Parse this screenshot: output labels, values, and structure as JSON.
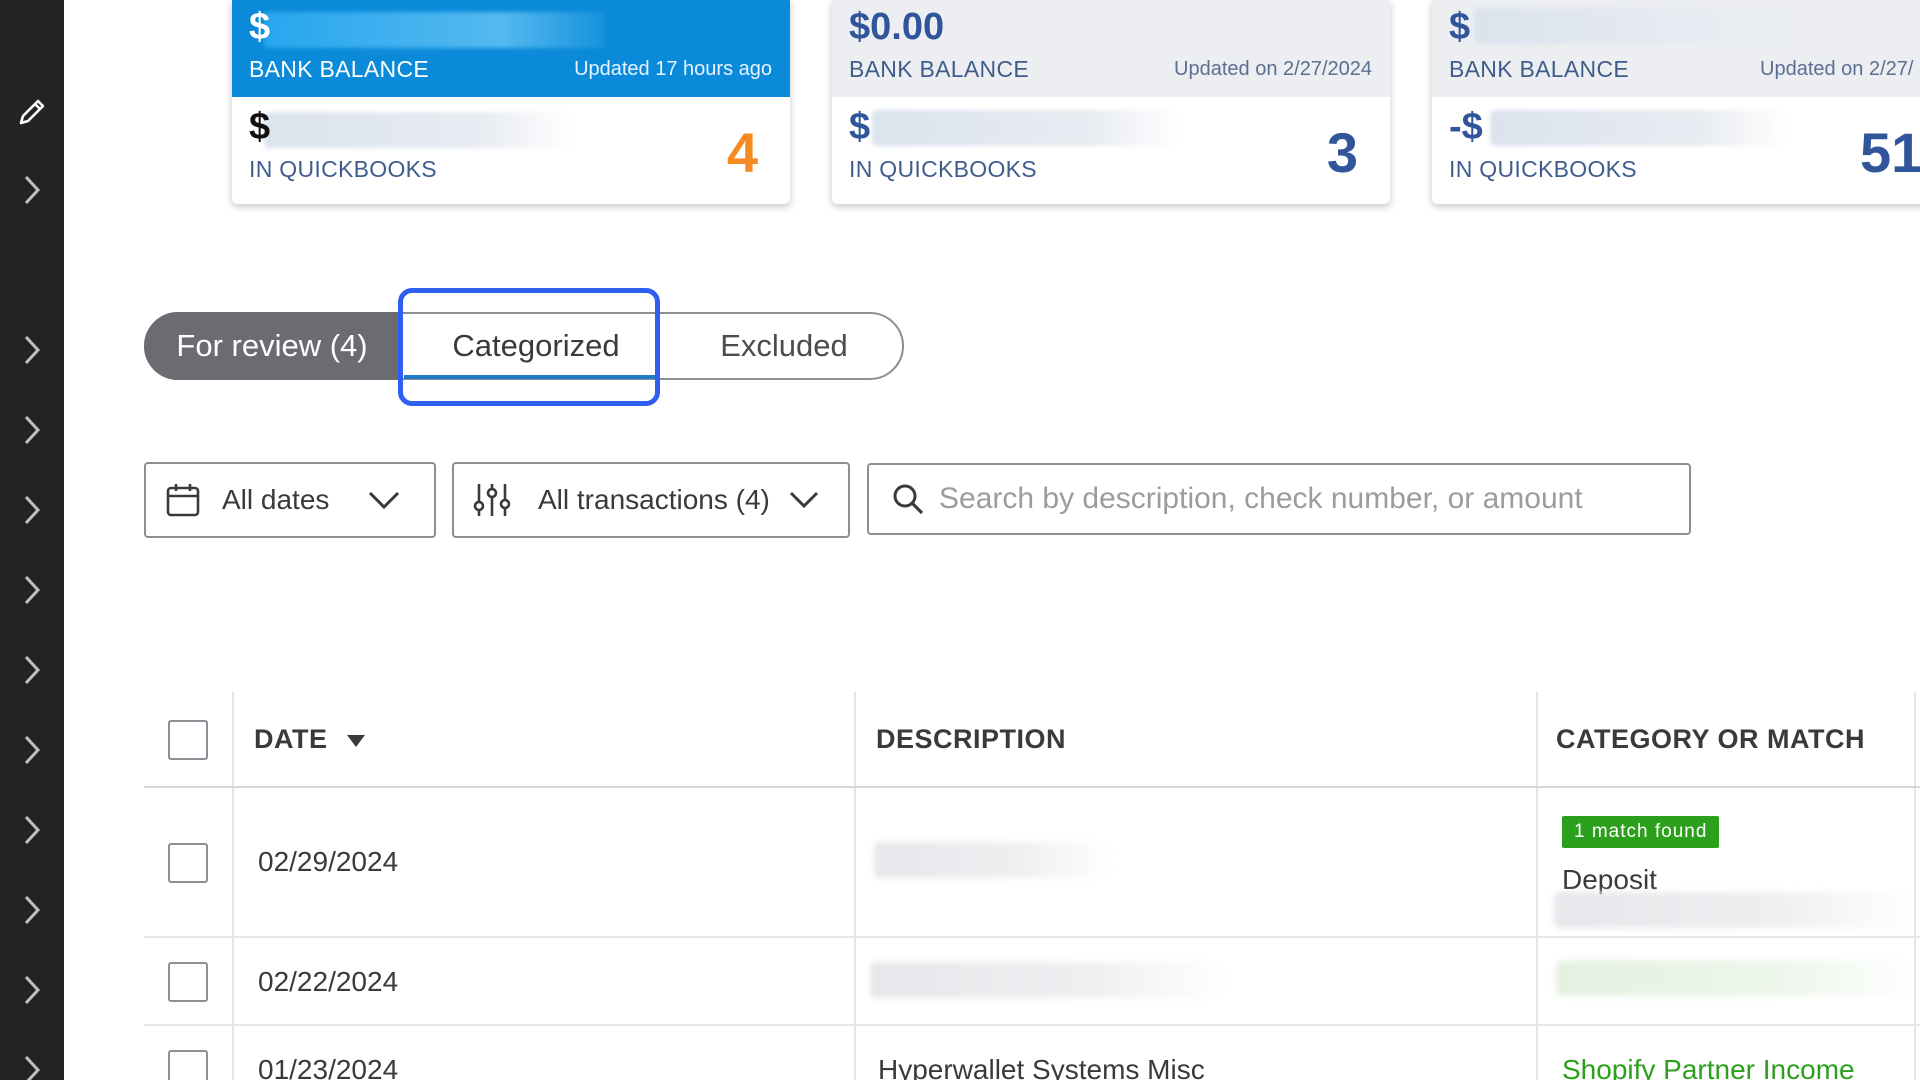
{
  "rail": {
    "icons": [
      "pencil-icon",
      "chevron-right-icon"
    ]
  },
  "cards": [
    {
      "balance": "$",
      "balance_label": "BANK BALANCE",
      "updated": "Updated 17 hours ago",
      "qb_amount": "$",
      "qb_label": "IN QUICKBOOKS",
      "count": "4"
    },
    {
      "balance": "$0.00",
      "balance_label": "BANK BALANCE",
      "updated": "Updated on 2/27/2024",
      "qb_amount": "$",
      "qb_label": "IN QUICKBOOKS",
      "count": "3"
    },
    {
      "balance": "$",
      "balance_label": "BANK BALANCE",
      "updated": "Updated on 2/27/",
      "qb_amount": "-$",
      "qb_label": "IN QUICKBOOKS",
      "count": "51"
    }
  ],
  "tabs": {
    "for_review": "For review (4)",
    "categorized": "Categorized",
    "excluded": "Excluded"
  },
  "filters": {
    "dates": "All dates",
    "transactions": "All transactions (4)",
    "search_placeholder": "Search by description, check number, or amount"
  },
  "table": {
    "headers": {
      "date": "DATE",
      "description": "DESCRIPTION",
      "category": "CATEGORY OR MATCH"
    },
    "rows": [
      {
        "date": "02/29/2024",
        "description": "",
        "badge": "1 match found",
        "category": "Deposit"
      },
      {
        "date": "02/22/2024",
        "description": "",
        "category": ""
      },
      {
        "date": "01/23/2024",
        "description": "Hyperwallet Systems Misc",
        "category": "Shopify Partner Income"
      }
    ]
  },
  "colors": {
    "active_card": "#0a8ad8",
    "for_review_count": "#f58a22",
    "focus_ring": "#2f5ff0",
    "match_badge": "#2ca01c"
  }
}
